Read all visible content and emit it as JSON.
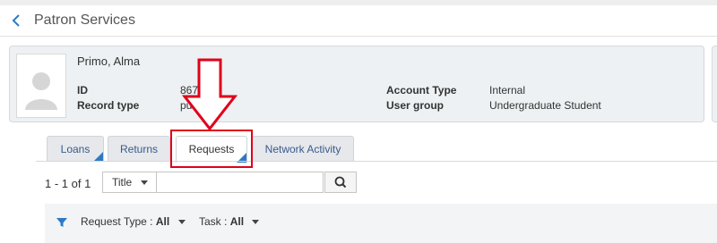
{
  "header": {
    "title": "Patron Services"
  },
  "patron": {
    "name": "Primo, Alma",
    "fields": {
      "id_label": "ID",
      "id_value": "8675309",
      "record_type_label": "Record type",
      "record_type_value": "public",
      "account_type_label": "Account Type",
      "account_type_value": "Internal",
      "user_group_label": "User group",
      "user_group_value": "Undergraduate Student"
    }
  },
  "tabs": [
    {
      "label": "Loans"
    },
    {
      "label": "Returns"
    },
    {
      "label": "Requests",
      "active": true
    },
    {
      "label": "Network Activity"
    }
  ],
  "search": {
    "count": "1 - 1 of 1",
    "field_select": "Title",
    "input_value": ""
  },
  "filters": {
    "request_type_label": "Request Type :",
    "request_type_value": "All",
    "task_label": "Task :",
    "task_value": "All"
  },
  "colors": {
    "accent": "#2f79c4",
    "annotation": "#e0001b",
    "card_bg": "#eef1f3"
  },
  "icons": {
    "back": "chevron-left-icon",
    "avatar": "user-silhouette-icon",
    "search": "search-icon",
    "filter": "filter-icon"
  }
}
